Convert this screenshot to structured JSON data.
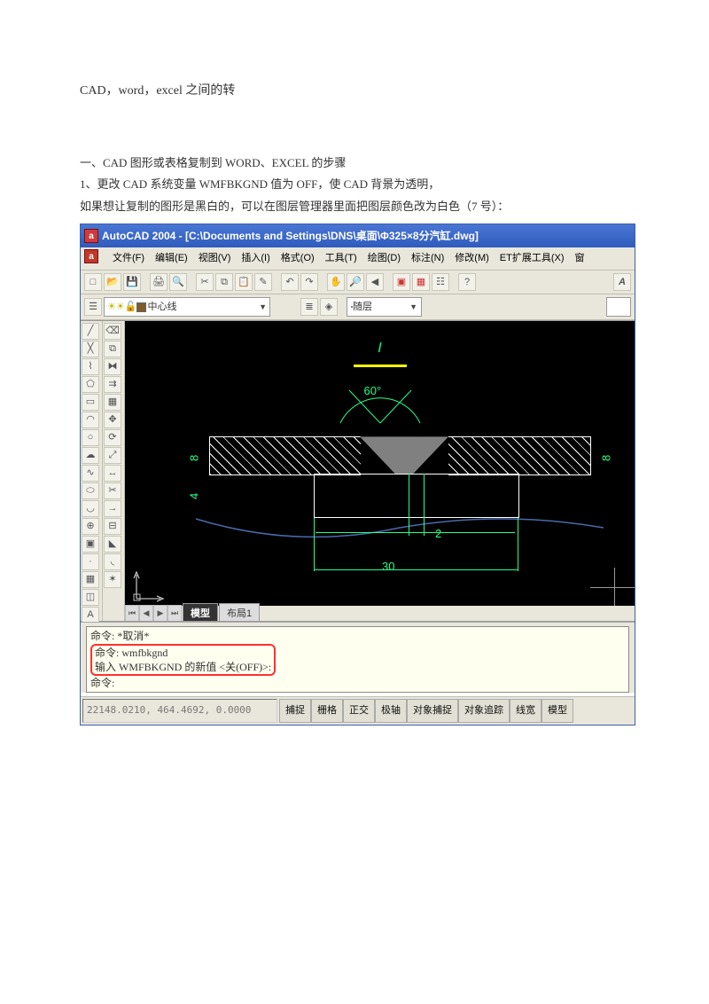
{
  "title": "CAD，word，excel 之间的转",
  "p1": "一、CAD 图形或表格复制到 WORD、EXCEL 的步骤",
  "p2": "1、更改 CAD 系统变量 WMFBKGND 值为 OFF，使 CAD 背景为透明，",
  "p3": "如果想让复制的图形是黑白的，可以在图层管理器里面把图层颜色改为白色（7 号）：",
  "screenshot": {
    "titlebar": "AutoCAD 2004 - [C:\\Documents and Settings\\DNS\\桌面\\Φ325×8分汽缸.dwg]",
    "menus": [
      "文件(F)",
      "编辑(E)",
      "视图(V)",
      "插入(I)",
      "格式(O)",
      "工具(T)",
      "绘图(D)",
      "标注(N)",
      "修改(M)",
      "ET扩展工具(X)",
      "窗"
    ],
    "layer_label": "中心线",
    "color_label": "随层",
    "tabs": {
      "active": "模型",
      "other": "布局1"
    },
    "drawing": {
      "italic_i": "I",
      "angle": "60°",
      "dim8": "8",
      "dim4": "4",
      "dim2": "2",
      "dim30": "30"
    },
    "cmd": {
      "l1": "命令: *取消*",
      "l2": "命令: wmfbkgnd",
      "l3": "输入 WMFBKGND 的新值 <关(OFF)>:",
      "l4": "命令:"
    },
    "status": {
      "coords": "22148.0210, 464.4692, 0.0000",
      "buttons": [
        "捕捉",
        "栅格",
        "正交",
        "极轴",
        "对象捕捉",
        "对象追踪",
        "线宽",
        "模型"
      ]
    }
  }
}
